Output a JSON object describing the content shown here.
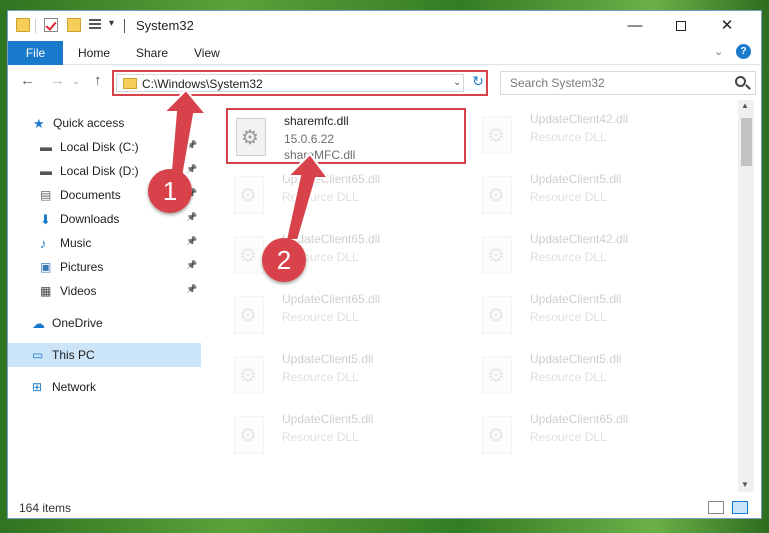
{
  "window": {
    "title": "System32"
  },
  "ribbon": {
    "tabs": [
      "File",
      "Home",
      "Share",
      "View"
    ]
  },
  "address": {
    "path": "C:\\Windows\\System32"
  },
  "search": {
    "placeholder": "Search System32"
  },
  "sidebar": {
    "items": [
      {
        "label": "Quick access",
        "icon": "star-icon",
        "pinned": false
      },
      {
        "label": "Local Disk (C:)",
        "icon": "drive-icon",
        "pinned": true
      },
      {
        "label": "Local Disk (D:)",
        "icon": "drive-icon",
        "pinned": true
      },
      {
        "label": "Documents",
        "icon": "documents-icon",
        "pinned": true
      },
      {
        "label": "Downloads",
        "icon": "download-arrow-icon",
        "pinned": true
      },
      {
        "label": "Music",
        "icon": "music-note-icon",
        "pinned": true
      },
      {
        "label": "Pictures",
        "icon": "pictures-icon",
        "pinned": true
      },
      {
        "label": "Videos",
        "icon": "film-icon",
        "pinned": true
      },
      {
        "label": "OneDrive",
        "icon": "cloud-icon",
        "pinned": false
      },
      {
        "label": "This PC",
        "icon": "monitor-icon",
        "pinned": false,
        "selected": true
      },
      {
        "label": "Network",
        "icon": "network-icon",
        "pinned": false
      }
    ]
  },
  "highlighted_file": {
    "name": "sharemfc.dll",
    "version": "15.0.6.22",
    "description": "shareMFC.dll"
  },
  "files": [
    {
      "name": "UpdateClient42.dll",
      "type": "Resource DLL"
    },
    {
      "name": "UpdateClient65.dll",
      "type": "Resource DLL"
    },
    {
      "name": "UpdateClient5.dll",
      "type": "Resource DLL"
    },
    {
      "name": "UpdateClient65.dll",
      "type": "Resource DLL"
    },
    {
      "name": "UpdateClient42.dll",
      "type": "Resource DLL"
    },
    {
      "name": "UpdateClient65.dll",
      "type": "Resource DLL"
    },
    {
      "name": "UpdateClient5.dll",
      "type": "Resource DLL"
    },
    {
      "name": "UpdateClient5.dll",
      "type": "Resource DLL"
    },
    {
      "name": "UpdateClient5.dll",
      "type": "Resource DLL"
    },
    {
      "name": "UpdateClient5.dll",
      "type": "Resource DLL"
    },
    {
      "name": "UpdateClient65.dll",
      "type": "Resource DLL"
    }
  ],
  "status": {
    "item_count": "164 items"
  },
  "annotations": {
    "step1": "1",
    "step2": "2",
    "color": "#d8434b"
  },
  "colors": {
    "accent": "#1979ca",
    "highlight": "#d8434b",
    "selected": "#cce4f7"
  }
}
